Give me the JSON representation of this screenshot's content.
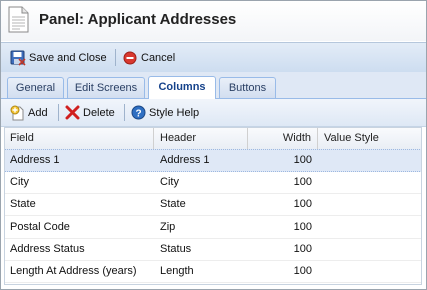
{
  "header": {
    "title": "Panel: Applicant Addresses",
    "icon": "document-icon"
  },
  "toolbar": {
    "save_close_label": "Save and Close",
    "cancel_label": "Cancel"
  },
  "tabs": [
    {
      "label": "General",
      "active": false
    },
    {
      "label": "Edit Screens",
      "active": false
    },
    {
      "label": "Columns",
      "active": true
    },
    {
      "label": "Buttons",
      "active": false
    }
  ],
  "grid_toolbar": {
    "add_label": "Add",
    "delete_label": "Delete",
    "style_help_label": "Style Help"
  },
  "grid": {
    "columns": [
      "Field",
      "Header",
      "Width",
      "Value Style"
    ],
    "rows": [
      {
        "field": "Address 1",
        "header": "Address 1",
        "width": "100",
        "value_style": "",
        "selected": true
      },
      {
        "field": "City",
        "header": "City",
        "width": "100",
        "value_style": "",
        "selected": false
      },
      {
        "field": "State",
        "header": "State",
        "width": "100",
        "value_style": "",
        "selected": false
      },
      {
        "field": "Postal Code",
        "header": "Zip",
        "width": "100",
        "value_style": "",
        "selected": false
      },
      {
        "field": "Address Status",
        "header": "Status",
        "width": "100",
        "value_style": "",
        "selected": false
      },
      {
        "field": "Length At Address (years)",
        "header": "Length",
        "width": "100",
        "value_style": "",
        "selected": false
      }
    ]
  },
  "colors": {
    "accent": "#15428b",
    "selected_row": "#dfe8f6",
    "toolbar": "#d4e1f2"
  }
}
